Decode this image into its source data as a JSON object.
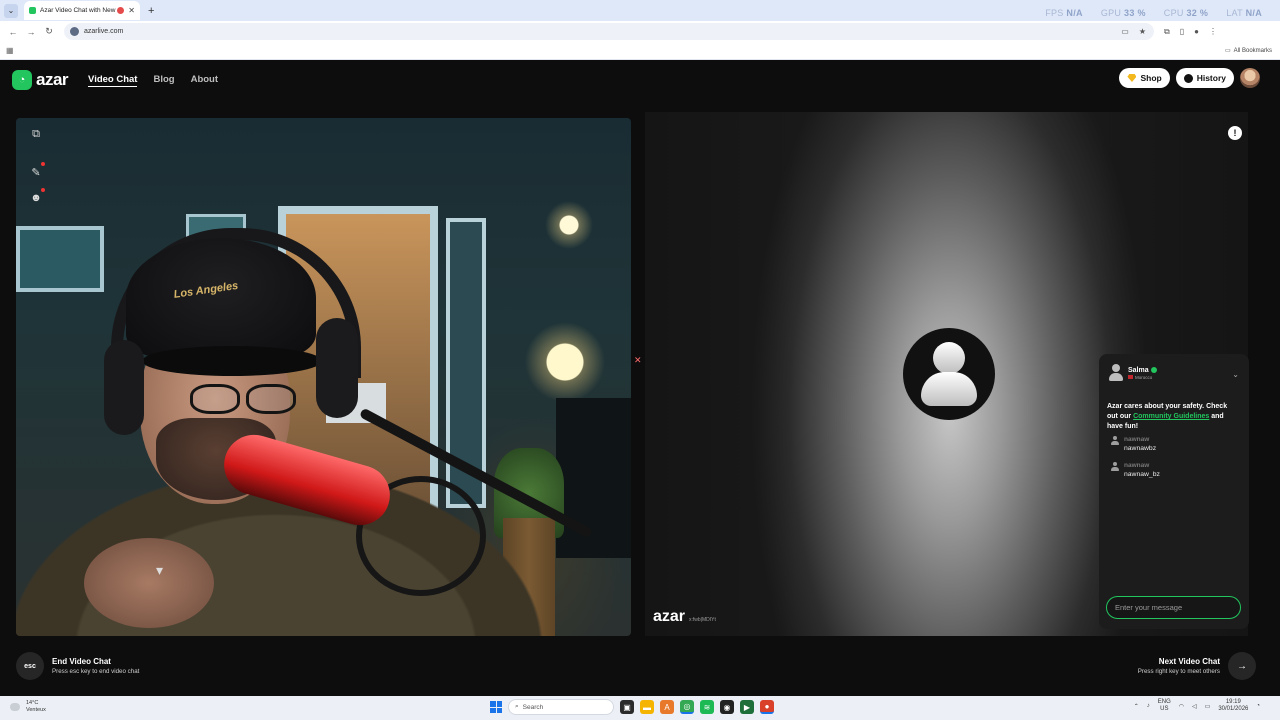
{
  "browser": {
    "tab_title": "Azar Video Chat with New",
    "new_tab_symbol": "+",
    "url": "azarlive.com",
    "bookmarks_label": "All Bookmarks",
    "perf": {
      "fps_label": "FPS",
      "fps_value": "N/A",
      "gpu_label": "GPU",
      "gpu_value": "33 %",
      "cpu_label": "CPU",
      "cpu_value": "32 %",
      "lat_label": "LAT",
      "lat_value": "N/A"
    }
  },
  "header": {
    "logo_text": "azar",
    "nav": [
      "Video Chat",
      "Blog",
      "About"
    ],
    "shop_label": "Shop",
    "history_label": "History"
  },
  "local_video": {
    "cap_text": "Los Angeles"
  },
  "remote_video": {
    "watermark": "azar",
    "watermark_id": "x:fwb|MDIYt"
  },
  "chat": {
    "partner_name": "Salma",
    "partner_country": "Morocco",
    "safety_prefix": "Azar cares about your safety. Check out our ",
    "safety_link": "Community Guidelines",
    "safety_suffix": " and have fun!",
    "messages": [
      {
        "user": "nawnaw",
        "text": "nawnawbz"
      },
      {
        "user": "nawnaw",
        "text": "nawnaw_bz"
      }
    ],
    "input_placeholder": "Enter your message"
  },
  "bottom": {
    "esc_key": "esc",
    "end_title": "End Video Chat",
    "end_sub": "Press esc key to end video chat",
    "next_title": "Next Video Chat",
    "next_sub": "Press right key to meet others"
  },
  "taskbar": {
    "weather_temp": "14°C",
    "weather_place": "Venteux",
    "search_placeholder": "Search",
    "lang_top": "ENG",
    "lang_bottom": "US",
    "time": "19:19",
    "date": "30/01/2026"
  },
  "colors": {
    "accent_green": "#22c55e",
    "background": "#0d0d0d"
  }
}
